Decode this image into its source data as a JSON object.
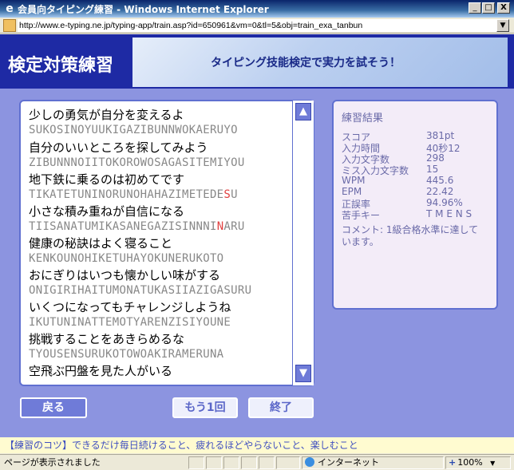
{
  "window": {
    "title": "会員向タイピング練習 - Windows Internet Explorer",
    "ie_icon": "e",
    "minimize": "_",
    "maximize": "□",
    "close": "X"
  },
  "address": {
    "url": "http://www.e-typing.ne.jp/typing-app/train.asp?id=650961&vm=0&tl=5&obj=train_exa_tanbun",
    "drop": "▼"
  },
  "header": {
    "logo": "検定対策練習",
    "tagline": "タイピング技能検定で実力を試そう！"
  },
  "sentences": [
    {
      "jp": "少しの勇気が自分を変えるよ",
      "romaji": "SUKOSINOYUUKIGAZIBUNNWOKAERUYO"
    },
    {
      "jp": "自分のいいところを探してみよう",
      "romaji": "ZIBUNNNOIITOKOROWOSAGASITEMIYOU"
    },
    {
      "jp": "地下鉄に乗るのは初めてです",
      "romaji_pre": "TIKATETUNINORUNOHAHAZIMETEDE",
      "romaji_err": "S",
      "romaji_post": "U"
    },
    {
      "jp": "小さな積み重ねが自信になる",
      "romaji_pre": "TIISANATUMIKASANEGAZISINNNI",
      "romaji_err": "N",
      "romaji_post": "ARU"
    },
    {
      "jp": "健康の秘訣はよく寝ること",
      "romaji": "KENKOUNOHIKETUHAYOKUNERUKOTO"
    },
    {
      "jp": "おにぎりはいつも懐かしい味がする",
      "romaji": "ONIGIRIHAITUMONATUKASIIAZIGASURU"
    },
    {
      "jp": "いくつになってもチャレンジしようね",
      "romaji": "IKUTUNINATTEMOTYARENZISIYOUNE"
    },
    {
      "jp": "挑戦することをあきらめるな",
      "romaji": "TYOUSENSURUKOTOWOAKIRAMERUNA"
    },
    {
      "jp": "空飛ぶ円盤を見た人がいる"
    }
  ],
  "scroll": {
    "up": "▲",
    "down": "▼"
  },
  "results": {
    "title": "練習結果",
    "rows": [
      {
        "label": "スコア",
        "value": "381pt"
      },
      {
        "label": "入力時間",
        "value": "40秒12"
      },
      {
        "label": "入力文字数",
        "value": "298"
      },
      {
        "label": "ミス入力文字数",
        "value": "15"
      },
      {
        "label": "WPM",
        "value": "445.6"
      },
      {
        "label": "EPM",
        "value": "22.42"
      },
      {
        "label": "正誤率",
        "value": "94.96%"
      },
      {
        "label": "苦手キー",
        "value": "T M E N S"
      }
    ],
    "comment_line1": "コメント: 1級合格水準に達して",
    "comment_line2": "います。"
  },
  "buttons": {
    "back": "戻る",
    "retry": "もう1回",
    "exit": "終了"
  },
  "tip": "【練習のコツ】できるだけ毎日続けること、疲れるほどやらないこと、楽しむこと",
  "status": {
    "text": "ページが表示されました",
    "zone": "インターネット",
    "zoom": "100%",
    "zoom_drop": "▼"
  }
}
